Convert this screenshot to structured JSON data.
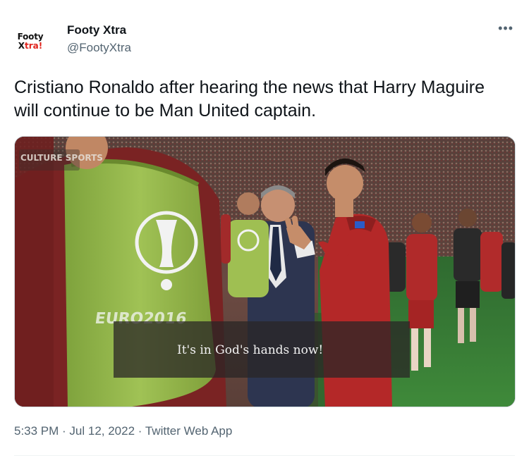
{
  "account": {
    "avatar_line1": "Footy",
    "avatar_line2_prefix": "X",
    "avatar_line2_accent": "tra!",
    "display_name": "Footy Xtra",
    "handle": "@FootyXtra"
  },
  "more_icon": "more-horizontal-icon",
  "tweet": {
    "text": "Cristiano Ronaldo after hearing the news that Harry Maguire will continue to be Man United captain."
  },
  "media": {
    "watermark": "CULTURE SPORTS",
    "bib_text": "EURO2016",
    "subtitle": "It's in God's hands now!"
  },
  "meta": {
    "text": "5:33 PM · Jul 12, 2022 · Twitter Web App"
  },
  "colors": {
    "text_primary": "#0f1419",
    "text_secondary": "#536471",
    "avatar_accent": "#e0231c",
    "bib_green": "#8fb045",
    "shirt_red": "#a52a2a",
    "pitch_green": "#2e6b2c"
  }
}
